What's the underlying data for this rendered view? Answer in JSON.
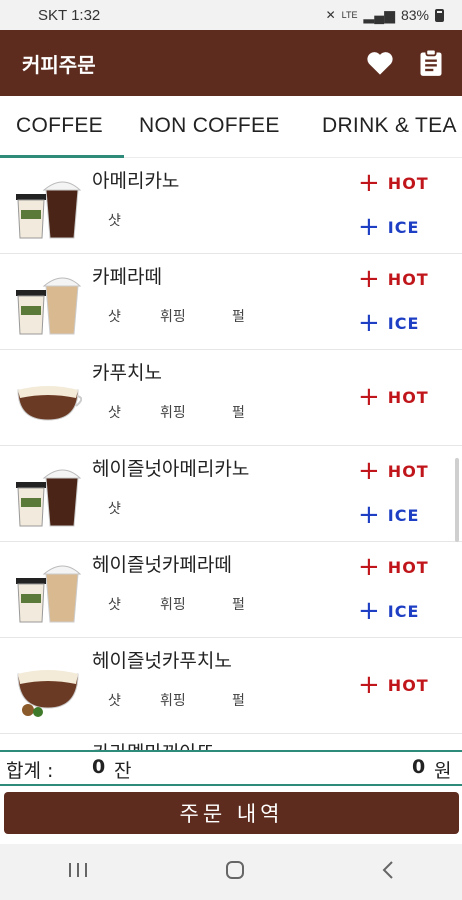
{
  "status": {
    "carrier_time": "SKT 1:32",
    "network": "LTE",
    "battery": "83%"
  },
  "appbar": {
    "title": "커피주문",
    "icons": [
      "heart-icon",
      "clipboard-icon"
    ]
  },
  "tabs": [
    {
      "label": "COFFEE",
      "selected": true
    },
    {
      "label": "NON COFFEE",
      "selected": false
    },
    {
      "label": "DRINK & TEA",
      "selected": false
    }
  ],
  "menu": [
    {
      "name": "아메리카노",
      "options": [
        "샷"
      ],
      "buttons": {
        "hot": "HOT",
        "ice": "ICE"
      }
    },
    {
      "name": "카페라떼",
      "options": [
        "샷",
        "휘핑",
        "펄"
      ],
      "buttons": {
        "hot": "HOT",
        "ice": "ICE"
      }
    },
    {
      "name": "카푸치노",
      "options": [
        "샷",
        "휘핑",
        "펄"
      ],
      "buttons": {
        "hot": "HOT"
      }
    },
    {
      "name": "헤이즐넛아메리카노",
      "options": [
        "샷"
      ],
      "buttons": {
        "hot": "HOT",
        "ice": "ICE"
      }
    },
    {
      "name": "헤이즐넛카페라떼",
      "options": [
        "샷",
        "휘핑",
        "펄"
      ],
      "buttons": {
        "hot": "HOT",
        "ice": "ICE"
      }
    },
    {
      "name": "헤이즐넛카푸치노",
      "options": [
        "샷",
        "휘핑",
        "펄"
      ],
      "buttons": {
        "hot": "HOT"
      }
    },
    {
      "name": "카라멜마끼아또",
      "options": [],
      "buttons": {}
    }
  ],
  "totals": {
    "label": "합계 :",
    "count": "0",
    "count_unit": "잔",
    "price": "0",
    "price_unit": "원"
  },
  "order_button": "주문 내역",
  "colors": {
    "primary": "#5d2c1f",
    "hot": "#c0161b",
    "ice": "#1e3fc4",
    "accent": "#2e8b7a"
  }
}
